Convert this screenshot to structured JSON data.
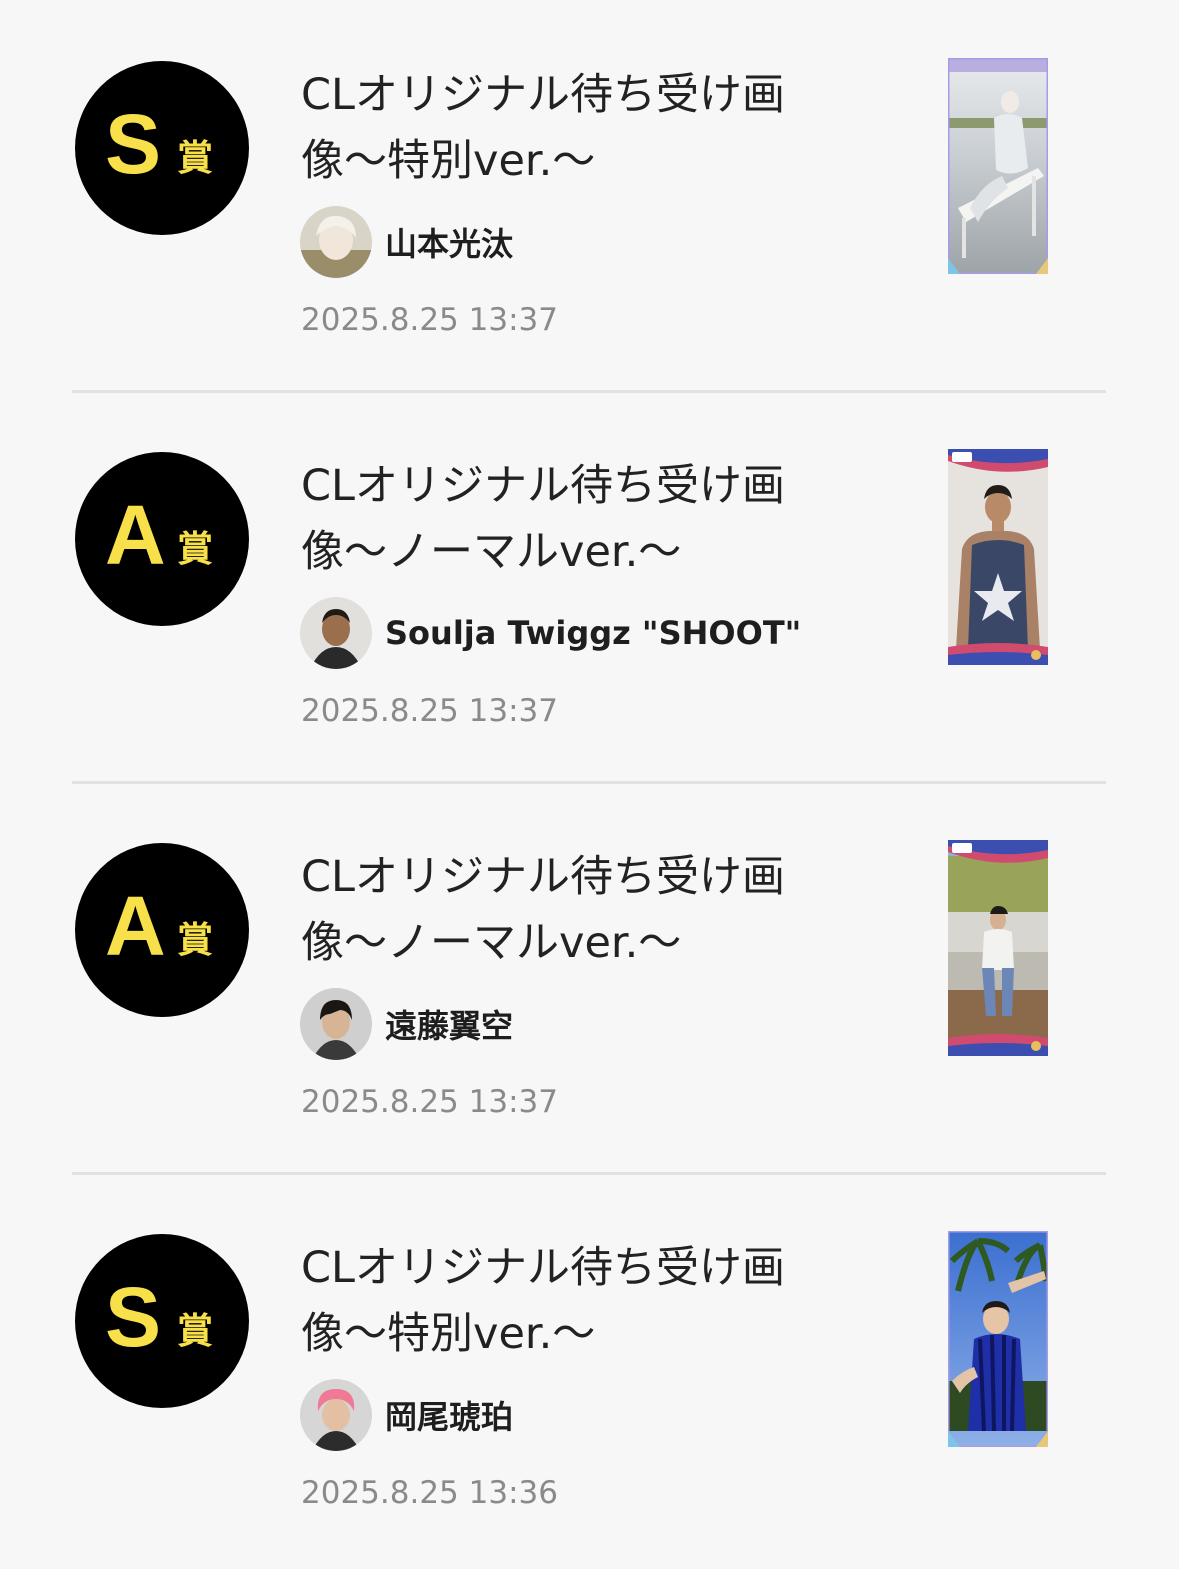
{
  "prize_list": {
    "items": [
      {
        "rank_letter": "S",
        "rank_suffix": "賞",
        "title": "CLオリジナル待ち受け画\n像～特別ver.～",
        "author": "山本光汰",
        "timestamp": "2025.8.25 13:37"
      },
      {
        "rank_letter": "A",
        "rank_suffix": "賞",
        "title": "CLオリジナル待ち受け画\n像～ノーマルver.～",
        "author": "Soulja Twiggz \"SHOOT\"",
        "timestamp": "2025.8.25 13:37"
      },
      {
        "rank_letter": "A",
        "rank_suffix": "賞",
        "title": "CLオリジナル待ち受け画\n像～ノーマルver.～",
        "author": "遠藤翼空",
        "timestamp": "2025.8.25 13:37"
      },
      {
        "rank_letter": "S",
        "rank_suffix": "賞",
        "title": "CLオリジナル待ち受け画\n像～特別ver.～",
        "author": "岡尾琥珀",
        "timestamp": "2025.8.25 13:36"
      }
    ]
  },
  "colors": {
    "background": "#f7f7f7",
    "badge_bg": "#000000",
    "badge_text": "#f7e04a",
    "title_text": "#222222",
    "timestamp_text": "#8a8a8a",
    "divider": "#e1e1e1"
  }
}
